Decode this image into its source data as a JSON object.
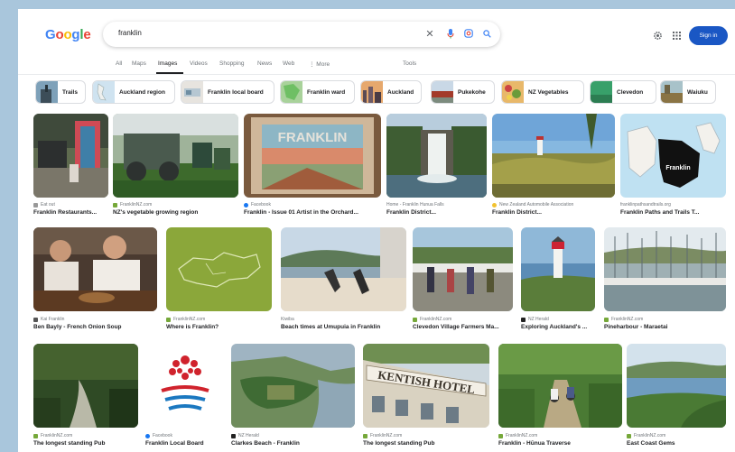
{
  "search": {
    "query": "franklin",
    "placeholder": ""
  },
  "header": {
    "signin_label": "Sign in",
    "accent_color": "#1a57c4",
    "icons": [
      "clear-icon",
      "mic-icon",
      "lens-icon",
      "search-icon",
      "settings-icon",
      "apps-icon"
    ]
  },
  "tabs": [
    {
      "label": "All",
      "active": false
    },
    {
      "label": "Maps",
      "active": false
    },
    {
      "label": "Images",
      "active": true
    },
    {
      "label": "Videos",
      "active": false
    },
    {
      "label": "Shopping",
      "active": false
    },
    {
      "label": "News",
      "active": false
    },
    {
      "label": "Web",
      "active": false
    },
    {
      "label": "⋮ More",
      "active": false
    },
    {
      "label": "Tools",
      "active": false
    }
  ],
  "chips": [
    {
      "label": "Trails"
    },
    {
      "label": "Auckland region"
    },
    {
      "label": "Franklin local board"
    },
    {
      "label": "Franklin ward"
    },
    {
      "label": "Auckland"
    },
    {
      "label": "Pukekohe"
    },
    {
      "label": "NZ Vegetables"
    },
    {
      "label": "Clevedon"
    },
    {
      "label": "Waiuku"
    }
  ],
  "results": [
    {
      "source": "Eat out",
      "caption": "Franklin Restaurants..."
    },
    {
      "source": "FranklinNZ.com",
      "caption": "NZ's vegetable growing region"
    },
    {
      "source": "Facebook",
      "caption": "Franklin - Issue 01 Artist in the Orchard..."
    },
    {
      "source": "Home - Franklin Hunua Falls",
      "caption": "Franklin District..."
    },
    {
      "source": "New Zealand Automobile Association",
      "caption": "Franklin District..."
    },
    {
      "source": "franklinpathsandtrails.org",
      "caption": "Franklin Paths and Trails T..."
    },
    {
      "source": "Kai Franklin",
      "caption": "Ben Bayly - French Onion Soup"
    },
    {
      "source": "FranklinNZ.com",
      "caption": "Where is Franklin?"
    },
    {
      "source": "Kiwiba",
      "caption": "Beach times at Umupuia in Franklin"
    },
    {
      "source": "FranklinNZ.com",
      "caption": "Clevedon Village Farmers Ma..."
    },
    {
      "source": "NZ Herald",
      "caption": "Exploring Auckland's ..."
    },
    {
      "source": "FranklinNZ.com",
      "caption": "Pineharbour - Maraetai"
    },
    {
      "source": "FranklinNZ.com",
      "caption": "The longest standing Pub"
    },
    {
      "source": "Facebook",
      "caption": "Franklin Local Board"
    },
    {
      "source": "NZ Herald",
      "caption": "Clarkes Beach - Franklin"
    },
    {
      "source": "FranklinNZ.com",
      "caption": "The longest standing Pub"
    },
    {
      "source": "FranklinNZ.com",
      "caption": "Franklin - Hūnua Traverse"
    },
    {
      "source": "FranklinNZ.com",
      "caption": "East Coast Gems"
    }
  ],
  "image_texts": {
    "franklin_sign": "FRANKLIN",
    "map_label": "Franklin",
    "hotel_sign": "KENTISH HOTEL"
  }
}
